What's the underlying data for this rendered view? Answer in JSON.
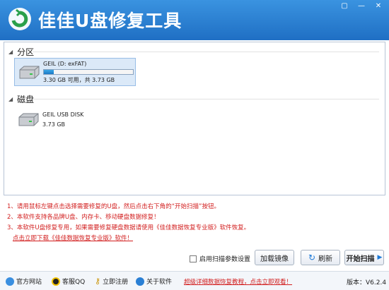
{
  "app": {
    "title": "佳佳U盘修复工具"
  },
  "window_buttons": [
    "▢",
    "—",
    "✕"
  ],
  "sections": {
    "partition": "分区",
    "disk": "磁盘"
  },
  "partition_drive": {
    "name": "GEIL (D: exFAT)",
    "size": "3.30 GB 可用，共 3.73 GB",
    "used_fraction": 0.115
  },
  "disk_drive": {
    "name": "GEIL USB DISK",
    "size": "3.73 GB"
  },
  "notes": [
    "1、请用鼠标左键点击选择需要修复的U盘，然后点击右下角的“开始扫描”按钮。",
    "2、本软件支持各品牌U盘、内存卡、移动硬盘数据修复！",
    "3、本软件U盘修复专用，如果需要修复硬盘数据请使用《佳佳数据恢复专业版》软件恢复。"
  ],
  "download_link": "点击立即下载《佳佳数据恢复专业版》软件！",
  "controls": {
    "scan_option": "启用扫描参数设置",
    "load_button": "加载镜像",
    "refresh_button": "刷新",
    "scan_button": "开始扫描"
  },
  "footer": {
    "website": "官方网站",
    "qq": "客服QQ",
    "register": "立即注册",
    "about": "关于软件",
    "tutorial_link": "超级详细数据恢复教程，点击立即观看！",
    "version_label": "版本：",
    "version": "V6.2.4"
  },
  "colors": {
    "title_bar": "#2b82d6",
    "note_red": "#d21f1f",
    "selected_bg": "#dbe9f8"
  }
}
